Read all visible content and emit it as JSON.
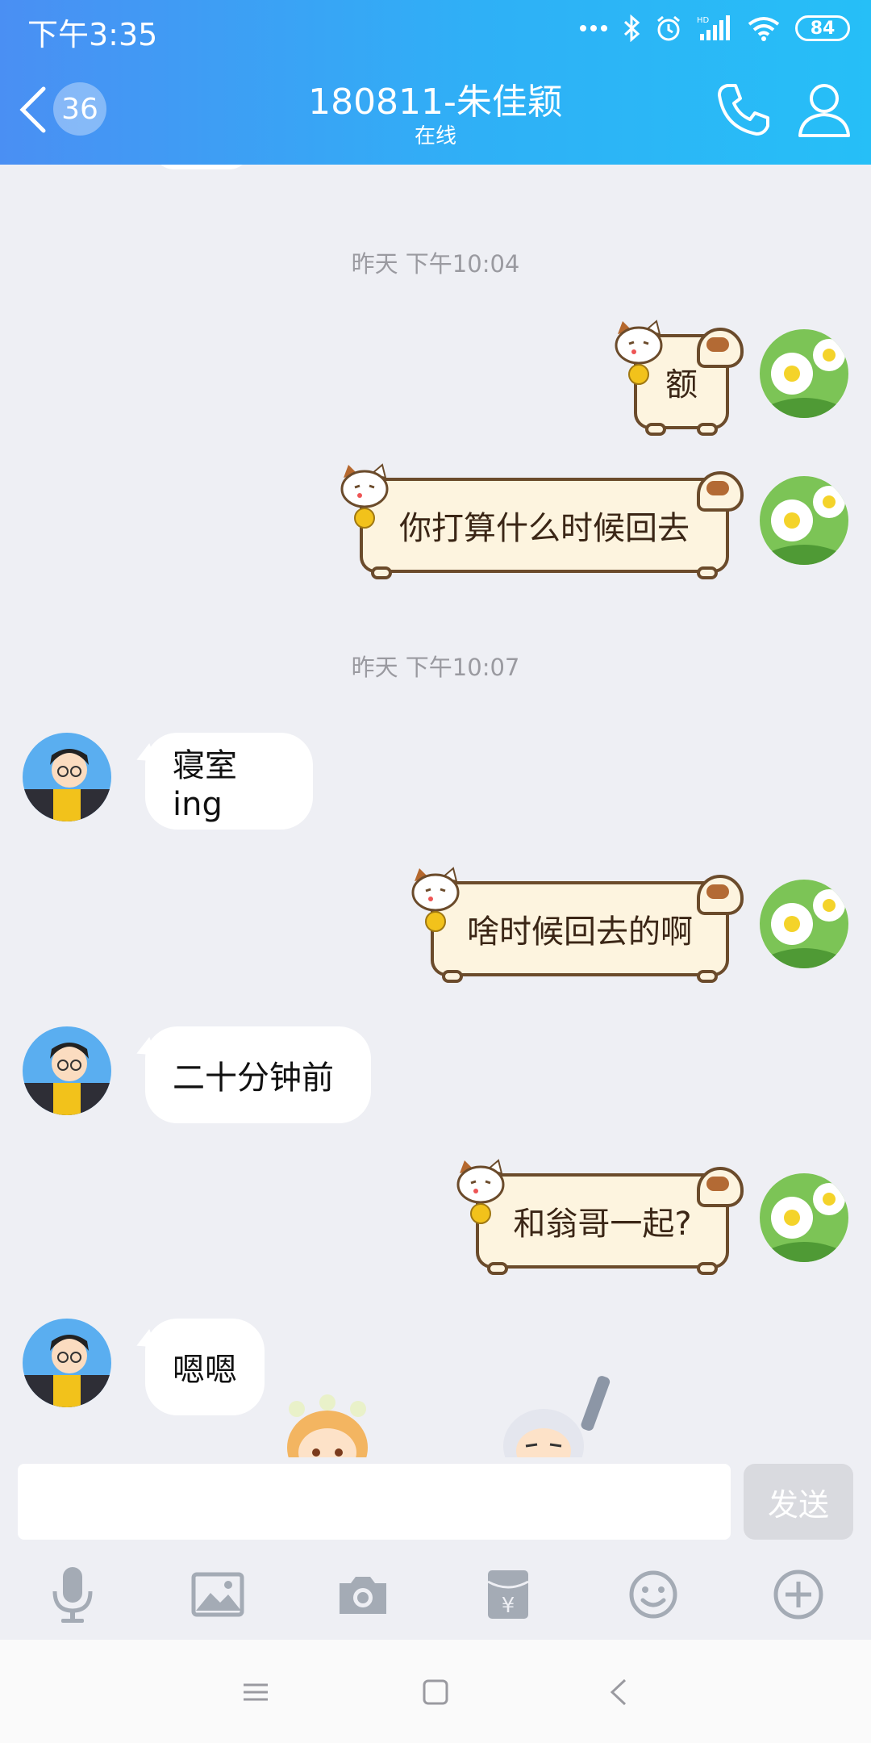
{
  "status": {
    "time": "下午3:35",
    "battery": "84"
  },
  "header": {
    "unread_count": "36",
    "title": "180811-朱佳颖",
    "subtitle": "在线"
  },
  "messages": {
    "ts1": "昨天 下午10:04",
    "m1": "额",
    "m2": "你打算什么时候回去",
    "ts2": "昨天 下午10:07",
    "m3": "寝室ing",
    "m4": "啥时候回去的啊",
    "m5": "二十分钟前",
    "m6": "和翁哥一起?",
    "m7": "嗯嗯"
  },
  "input": {
    "send_label": "发送",
    "placeholder": ""
  },
  "icons": {
    "back": "chevron-left-icon",
    "call": "phone-icon",
    "profile": "person-icon",
    "voice": "microphone-icon",
    "image": "image-icon",
    "camera": "camera-icon",
    "red_packet": "red-packet-icon",
    "emoji": "emoji-icon",
    "more": "plus-circle-icon"
  },
  "colors": {
    "header_start": "#4a8ff3",
    "header_end": "#26bff7",
    "background": "#eeeff4"
  }
}
